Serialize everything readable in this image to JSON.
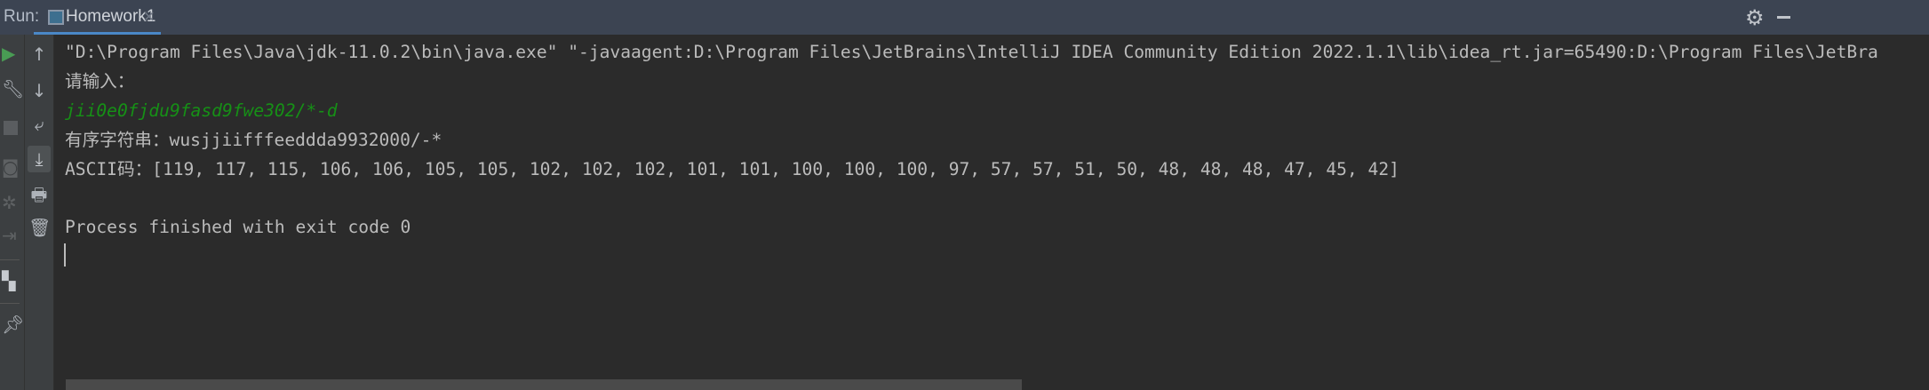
{
  "header": {
    "run_label": "Run:",
    "tab_title": "Homework1",
    "tab_close": "×"
  },
  "toolbar_left": {
    "icons": [
      "run-icon",
      "wrench-icon",
      "stop-icon",
      "camera-icon",
      "debug-icon",
      "exit-icon",
      "layout-icon",
      "pin-icon"
    ]
  },
  "toolbar_right": {
    "icons": [
      "arrow-up-icon",
      "arrow-down-icon",
      "soft-wrap-icon",
      "scroll-to-end-icon",
      "print-icon",
      "trash-icon"
    ]
  },
  "console": {
    "lines": [
      "\"D:\\Program Files\\Java\\jdk-11.0.2\\bin\\java.exe\" \"-javaagent:D:\\Program Files\\JetBrains\\IntelliJ IDEA Community Edition 2022.1.1\\lib\\idea_rt.jar=65490:D:\\Program Files\\JetBra",
      "请输入：",
      "jii0e0fjdu9fasd9fwe302/*-d",
      "有序字符串：wusjjiifffeeddda9932000/-*",
      "ASCII码：[119, 117, 115, 106, 106, 105, 105, 102, 102, 102, 101, 101, 100, 100, 100, 97, 57, 57, 51, 50, 48, 48, 48, 47, 45, 42]",
      "",
      "Process finished with exit code 0"
    ]
  },
  "colors": {
    "header": "#3c4452",
    "background": "#2b2b2b",
    "text": "#bbbbbb",
    "input": "#169016",
    "accent": "#4a88c7"
  }
}
